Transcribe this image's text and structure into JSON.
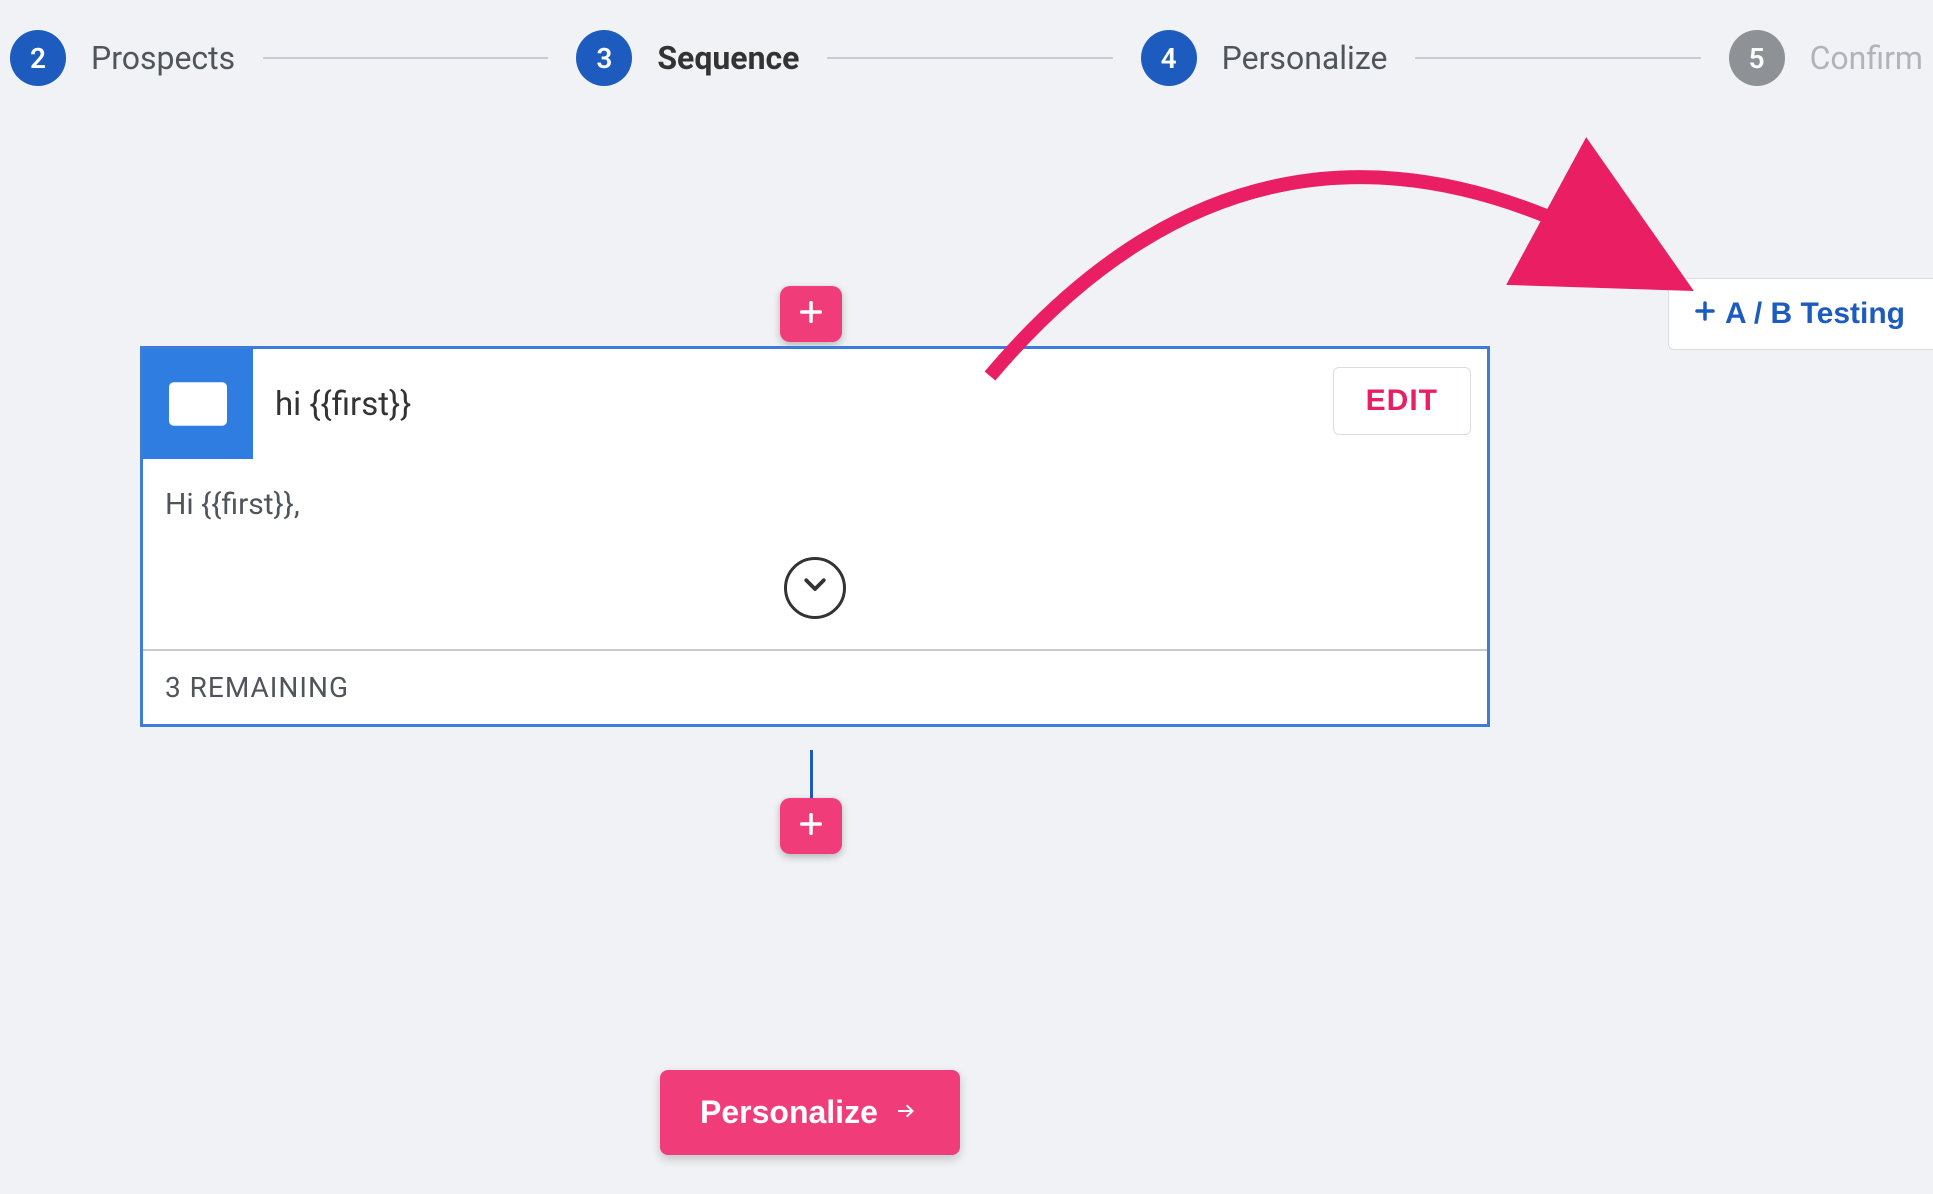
{
  "stepper": {
    "steps": [
      {
        "number": "2",
        "label": "Prospects",
        "circleClass": "blue",
        "labelClass": ""
      },
      {
        "number": "3",
        "label": "Sequence",
        "circleClass": "blue",
        "labelClass": "active"
      },
      {
        "number": "4",
        "label": "Personalize",
        "circleClass": "blue",
        "labelClass": ""
      },
      {
        "number": "5",
        "label": "Confirm",
        "circleClass": "grey",
        "labelClass": "muted"
      }
    ]
  },
  "sequence_card": {
    "subject": "hi {{first}}",
    "body_preview": "Hi {{first}},",
    "edit_label": "EDIT",
    "remaining_label": "3 REMAINING"
  },
  "ab_testing": {
    "label": "A / B Testing"
  },
  "cta": {
    "label": "Personalize"
  },
  "colors": {
    "accent_blue": "#1d5bbf",
    "accent_pink": "#f13c7a",
    "bg": "#f0f2f5"
  },
  "icons": {
    "mail": "mail-icon",
    "plus": "plus-icon",
    "chevron_down": "chevron-down-icon",
    "arrow_right": "arrow-right-icon"
  }
}
